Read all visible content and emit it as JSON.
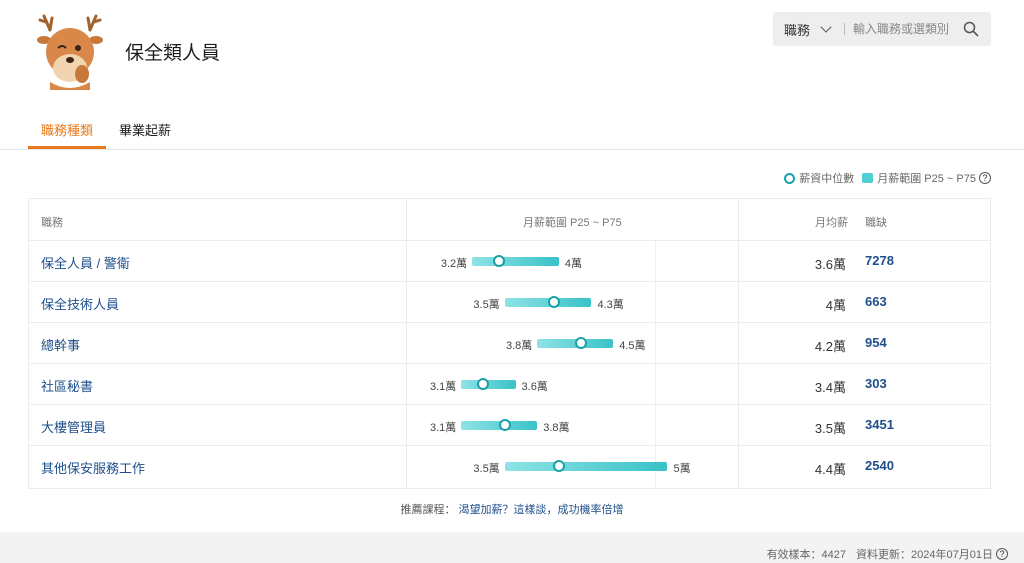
{
  "header": {
    "title": "保全類人員",
    "mascot": "deer-mascot-icon"
  },
  "search": {
    "category": "職務",
    "placeholder": "輸入職務或選類別",
    "icon": "search-icon"
  },
  "tabs": [
    {
      "label": "職務種類",
      "active": true
    },
    {
      "label": "畢業起薪",
      "active": false
    }
  ],
  "legend": {
    "median": "薪資中位數",
    "range": "月薪範圍 P25 ~ P75",
    "help": "?"
  },
  "table": {
    "headers": {
      "job": "職務",
      "range": "月薪範圍 P25 ~ P75",
      "avg": "月均薪",
      "vacancy": "職缺"
    },
    "rows": [
      {
        "job": "保全人員 / 警衛",
        "p25": 3.2,
        "median": 3.45,
        "p75": 4,
        "p25_label": "3.2萬",
        "p75_label": "4萬",
        "avg": "3.6萬",
        "vacancy": "7278"
      },
      {
        "job": "保全技術人員",
        "p25": 3.5,
        "median": 3.95,
        "p75": 4.3,
        "p25_label": "3.5萬",
        "p75_label": "4.3萬",
        "avg": "4萬",
        "vacancy": "663"
      },
      {
        "job": "總幹事",
        "p25": 3.8,
        "median": 4.2,
        "p75": 4.5,
        "p25_label": "3.8萬",
        "p75_label": "4.5萬",
        "avg": "4.2萬",
        "vacancy": "954"
      },
      {
        "job": "社區秘書",
        "p25": 3.1,
        "median": 3.3,
        "p75": 3.6,
        "p25_label": "3.1萬",
        "p75_label": "3.6萬",
        "avg": "3.4萬",
        "vacancy": "303"
      },
      {
        "job": "大樓管理員",
        "p25": 3.1,
        "median": 3.5,
        "p75": 3.8,
        "p25_label": "3.1萬",
        "p75_label": "3.8萬",
        "avg": "3.5萬",
        "vacancy": "3451"
      },
      {
        "job": "其他保安服務工作",
        "p25": 3.5,
        "median": 4.0,
        "p75": 5,
        "p25_label": "3.5萬",
        "p75_label": "5萬",
        "avg": "4.4萬",
        "vacancy": "2540"
      }
    ]
  },
  "course": {
    "label": "推薦課程：",
    "link": "渴望加薪？這樣談，成功機率倍增"
  },
  "footer": {
    "sample": "有效樣本：4427",
    "updated": "資料更新：2024年07月01日",
    "help": "?"
  },
  "colors": {
    "accent": "#e8791a",
    "link": "#1e4f8c",
    "median": "#1aa0a8",
    "bar": "#39c2c7"
  }
}
